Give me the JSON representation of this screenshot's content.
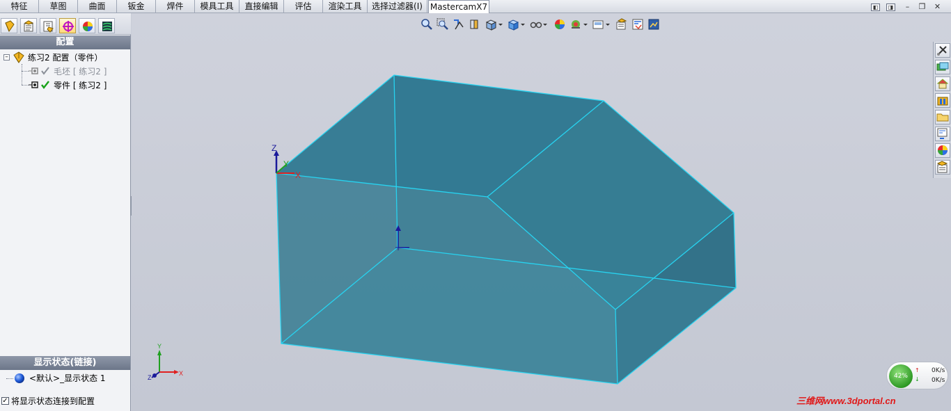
{
  "tabs": [
    {
      "label": "特征"
    },
    {
      "label": "草图"
    },
    {
      "label": "曲面"
    },
    {
      "label": "钣金"
    },
    {
      "label": "焊件"
    },
    {
      "label": "模具工具"
    },
    {
      "label": "直接编辑"
    },
    {
      "label": "评估"
    },
    {
      "label": "渲染工具"
    },
    {
      "label": "选择过滤器(I)"
    },
    {
      "label": "MastercamX7",
      "active": true
    }
  ],
  "config_panel": {
    "header": "配置",
    "tree": {
      "root_label": "练习2 配置（零件）",
      "children": [
        {
          "label": "毛坯 [ 练习2 ]",
          "state": "inactive"
        },
        {
          "label": "零件 [ 练习2 ]",
          "state": "active"
        }
      ]
    }
  },
  "display_state_panel": {
    "header": "显示状态(链接)",
    "item_label": "<默认>_显示状态 1",
    "link_checkbox_label": "将显示状态连接到配置",
    "link_checked": true
  },
  "viewport": {
    "triad_labels": {
      "x": "X",
      "y": "Y",
      "z": "Z"
    },
    "model_color": "#3a8aa0",
    "edge_color": "#27d3f0"
  },
  "network_widget": {
    "percent": "42%",
    "upload_rate": "0K/s",
    "download_rate": "0K/s"
  },
  "watermark": "三维网www.3dportal.cn",
  "colors": {
    "accent_header": "#6c7689",
    "watermark": "#e01818",
    "axis_x": "#e02020",
    "axis_y": "#20a020",
    "axis_z": "#1a1a9a"
  }
}
